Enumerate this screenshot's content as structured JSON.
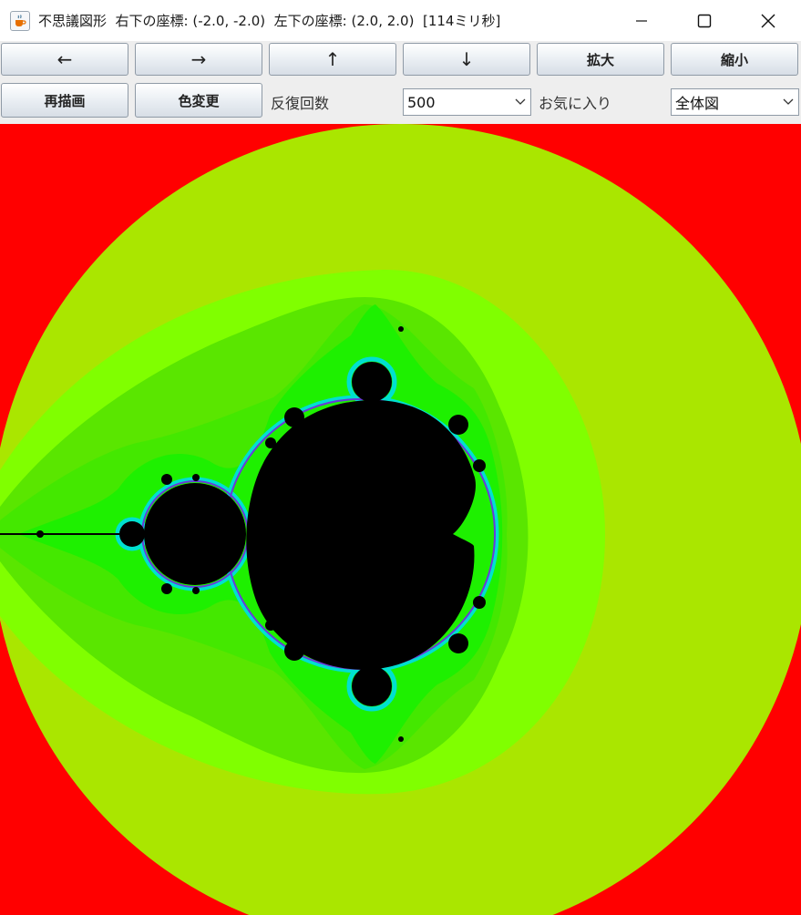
{
  "window": {
    "title": "不思議図形  右下の座標: (-2.0, -2.0)  左下の座標: (2.0, 2.0)  [114ミリ秒]",
    "app_icon": "java-cup-icon",
    "controls": {
      "minimize_icon": "minimize-icon",
      "maximize_icon": "maximize-icon",
      "close_icon": "close-icon"
    }
  },
  "toolbar": {
    "left_label": "←",
    "right_label": "→",
    "up_label": "↑",
    "down_label": "↓",
    "zoom_in_label": "拡大",
    "zoom_out_label": "縮小",
    "redraw_label": "再描画",
    "color_change_label": "色変更",
    "iterations_label": "反復回数",
    "iterations_value": "500",
    "favorites_label": "お気に入り",
    "favorites_value": "全体図"
  },
  "canvas": {
    "description": "mandelbrot-set",
    "colors": {
      "background": "#ff0000",
      "band_outer": "#aae600",
      "band_2": "#80ff00",
      "band_3": "#5ae600",
      "band_4": "#44e800",
      "band_5": "#1ef000",
      "edge": "#00e8c8",
      "set": "#000000"
    }
  }
}
